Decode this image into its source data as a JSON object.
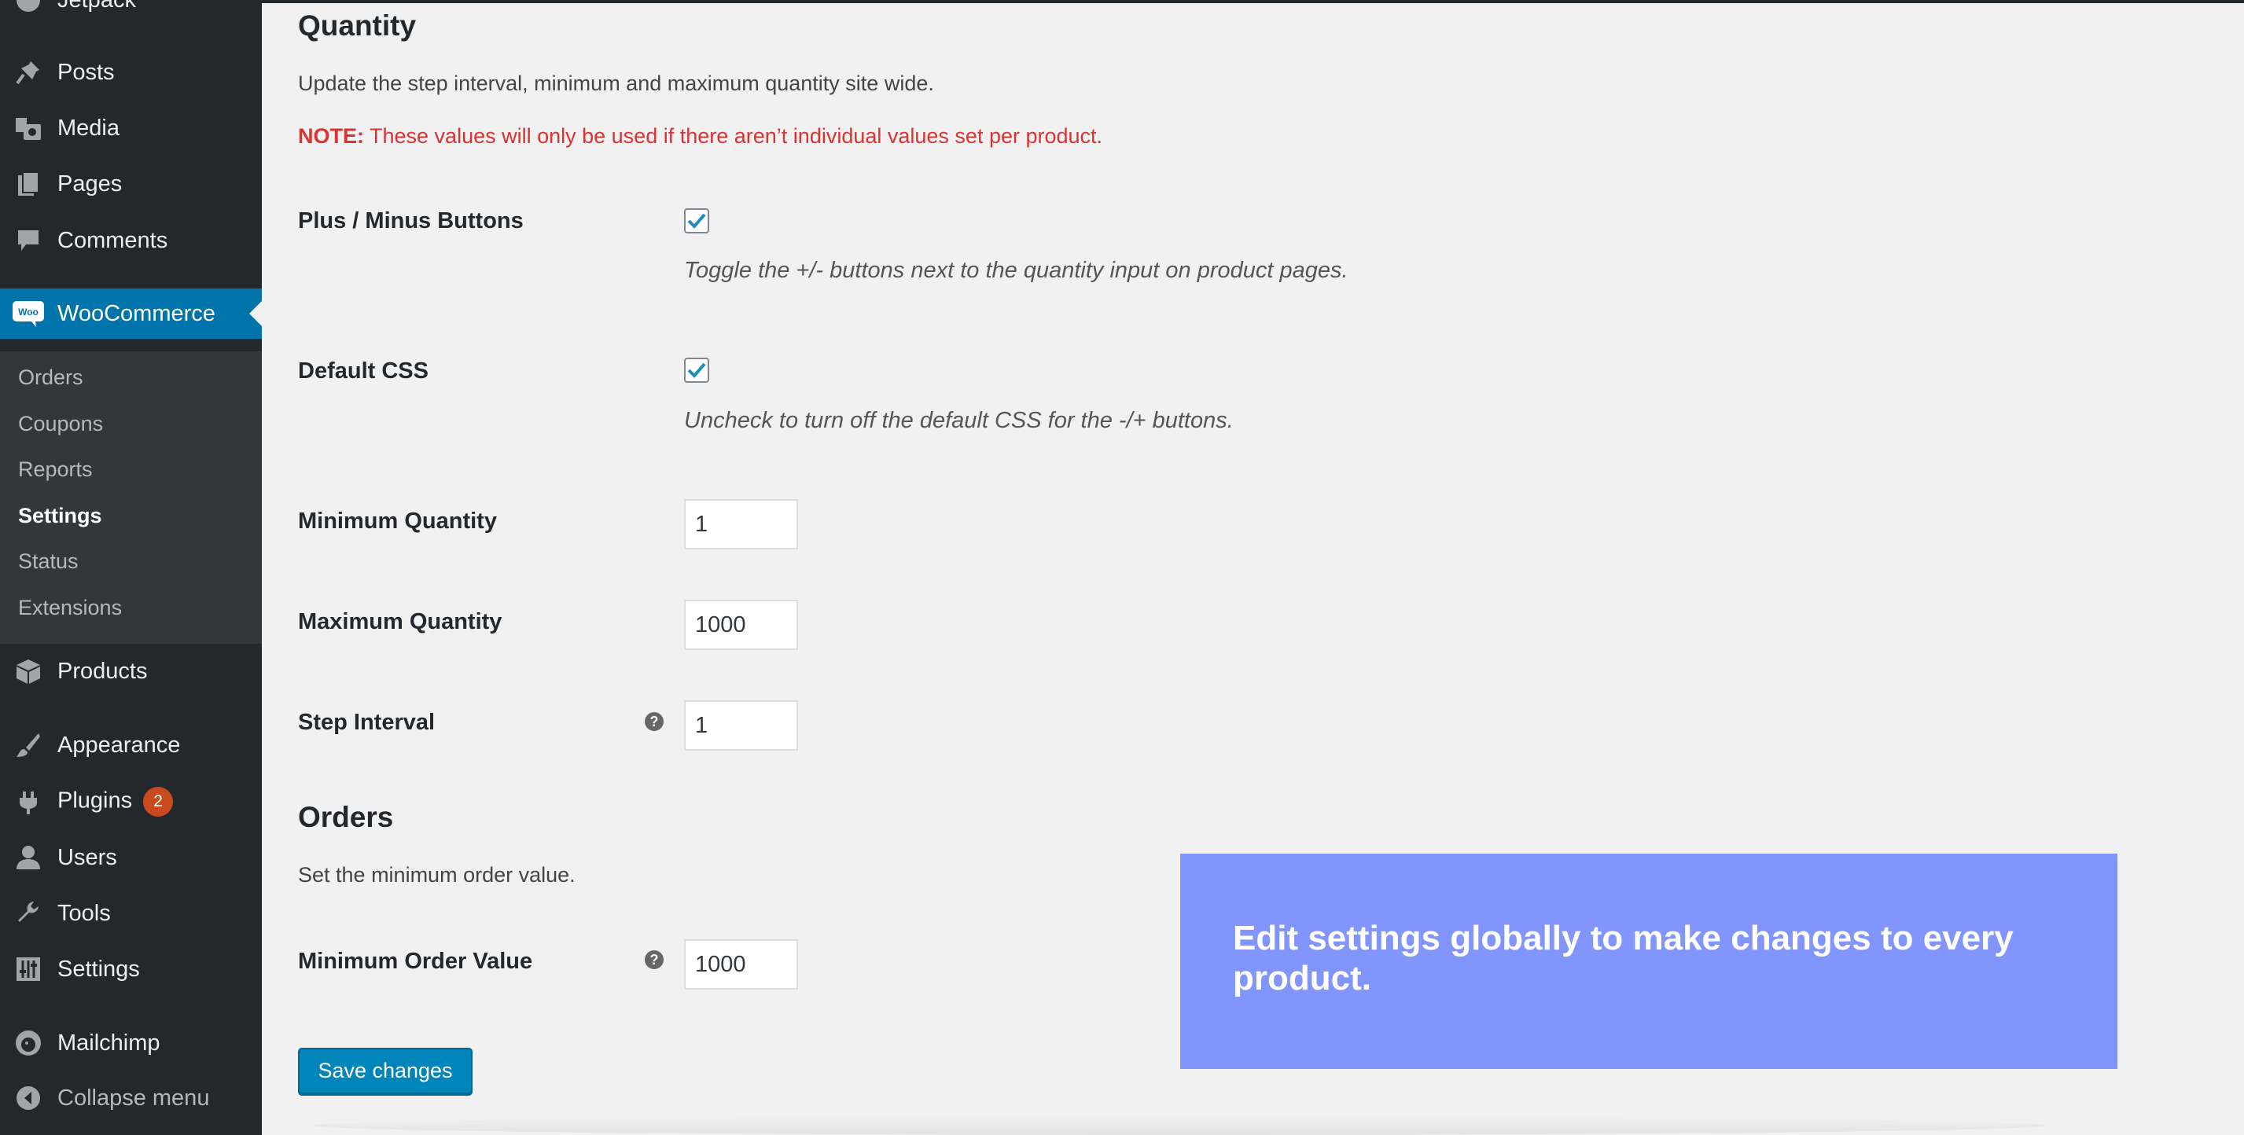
{
  "sidebar": {
    "cut_item": "Jetpack",
    "items": [
      {
        "label": "Posts",
        "icon": "pin-icon"
      },
      {
        "label": "Media",
        "icon": "media-icon"
      },
      {
        "label": "Pages",
        "icon": "pages-icon"
      },
      {
        "label": "Comments",
        "icon": "comment-icon"
      },
      {
        "label": "WooCommerce",
        "icon": "woo-icon"
      },
      {
        "label": "Products",
        "icon": "box-icon"
      },
      {
        "label": "Appearance",
        "icon": "brush-icon"
      },
      {
        "label": "Plugins",
        "icon": "plug-icon",
        "badge": "2"
      },
      {
        "label": "Users",
        "icon": "user-icon"
      },
      {
        "label": "Tools",
        "icon": "wrench-icon"
      },
      {
        "label": "Settings",
        "icon": "sliders-icon"
      },
      {
        "label": "Mailchimp",
        "icon": "mailchimp-icon"
      }
    ],
    "woo_logo_text": "Woo",
    "submenu": [
      "Orders",
      "Coupons",
      "Reports",
      "Settings",
      "Status",
      "Extensions"
    ],
    "collapse": "Collapse menu"
  },
  "quantity": {
    "title": "Quantity",
    "description": "Update the step interval, minimum and maximum quantity site wide.",
    "note_prefix": "NOTE:",
    "note_text": " These values will only be used if there aren’t individual values set per product.",
    "plus_minus_label": "Plus / Minus Buttons",
    "plus_minus_desc": "Toggle the +/- buttons next to the quantity input on product pages.",
    "default_css_label": "Default CSS",
    "default_css_desc": "Uncheck to turn off the default CSS for the -/+ buttons.",
    "min_label": "Minimum Quantity",
    "min_value": "1",
    "max_label": "Maximum Quantity",
    "max_value": "1000",
    "step_label": "Step Interval",
    "step_value": "1",
    "help_glyph": "?"
  },
  "orders": {
    "title": "Orders",
    "description": "Set the minimum order value.",
    "min_order_label": "Minimum Order Value",
    "min_order_value": "1000"
  },
  "save_label": "Save changes",
  "callout": "Edit settings globally to make changes to every product.",
  "colors": {
    "sidebar_bg": "#23282d",
    "active_bg": "#0073aa",
    "note_red": "#dc3232",
    "callout_bg": "#8195fd",
    "button_blue": "#0085ba"
  }
}
